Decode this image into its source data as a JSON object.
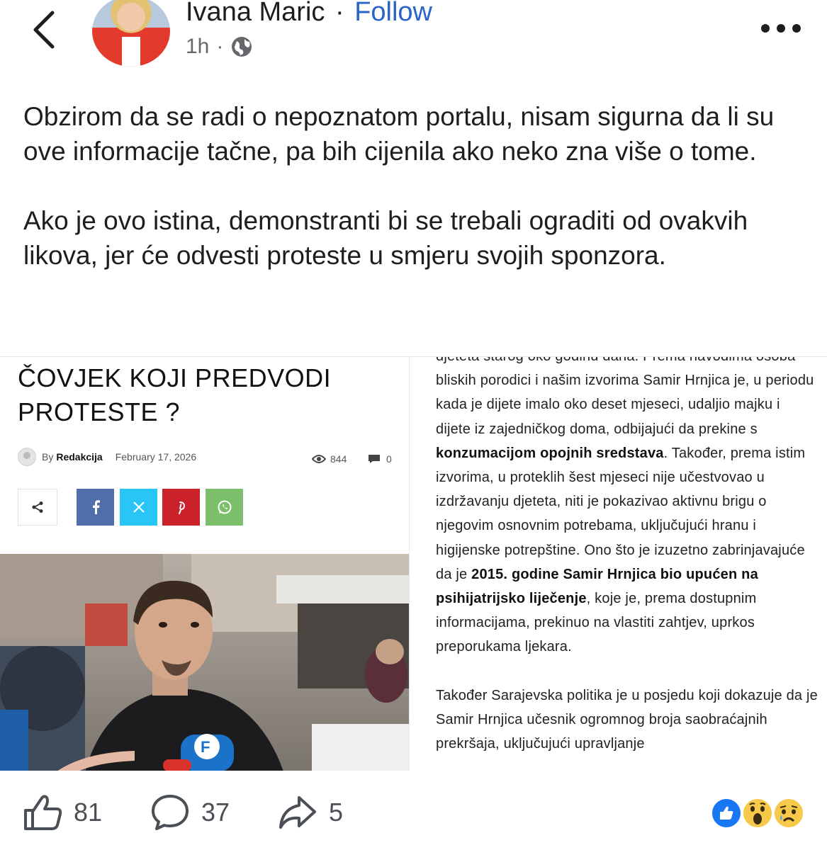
{
  "header": {
    "author": "Ivana Maric",
    "separator": "·",
    "follow_label": "Follow",
    "time": "1h",
    "meta_sep": "·",
    "privacy_icon": "globe-icon"
  },
  "post": {
    "paragraphs": [
      "Obzirom da se radi o nepoznatom portalu, nisam sigurna da li su ove informacije tačne, pa bih cijenila ako neko zna više o tome.",
      "Ako je ovo istina, demonstranti bi se trebali ograditi od ovakvih likova, jer će odvesti proteste u smjeru svojih sponzora."
    ]
  },
  "article": {
    "title": "ČOVJEK KOJI PREDVODI PROTESTE ?",
    "by_label": "By",
    "author": "Redakcija",
    "date": "February 17, 2026",
    "views": "844",
    "comments": "0",
    "share_buttons": [
      "facebook-icon",
      "x-icon",
      "pinterest-icon",
      "whatsapp-icon"
    ],
    "share_colors": {
      "facebook": "#516eab",
      "x": "#29c5f6",
      "pinterest": "#ca212a",
      "whatsapp": "#7bbf6a"
    },
    "body_p1": [
      {
        "t": "djeteta starog oko godinu dana. Prema navodima osoba bliskih porodici i našim izvorima Samir Hrnjica je, u periodu kada je dijete imalo oko deset mjeseci, udaljio majku i dijete iz zajedničkog doma, odbijajući da prekine s "
      },
      {
        "t": "konzumacijom opojnih sredstava",
        "b": true
      },
      {
        "t": ".  Također, prema istim izvorima, u proteklih šest mjeseci nije učestvovao u izdržavanju djeteta, niti je pokazivao aktivnu brigu o njegovim osnovnim potrebama, uključujući hranu i higijenske potrepštine. Ono što je izuzetno zabrinjavajuće da je "
      },
      {
        "t": "2015. godine Samir Hrnjica bio upućen na psihijatrijsko liječenje",
        "b": true
      },
      {
        "t": ", koje je, prema dostupnim informacijama, prekinuo na vlastiti zahtjev, uprkos preporukama ljekara."
      }
    ],
    "body_p2": "Također Sarajevska politika je u posjedu koji dokazuje da je Samir Hrnjica učesnik ogromnog broja saobraćajnih prekršaja, uključujući upravljanje"
  },
  "actions": {
    "likes": "81",
    "comments": "37",
    "shares": "5"
  },
  "reactions": [
    "like",
    "wow",
    "sad"
  ],
  "colors": {
    "follow": "#2a63c9",
    "like_blue": "#1877f2",
    "reaction_yellow": "#f7c94a"
  }
}
